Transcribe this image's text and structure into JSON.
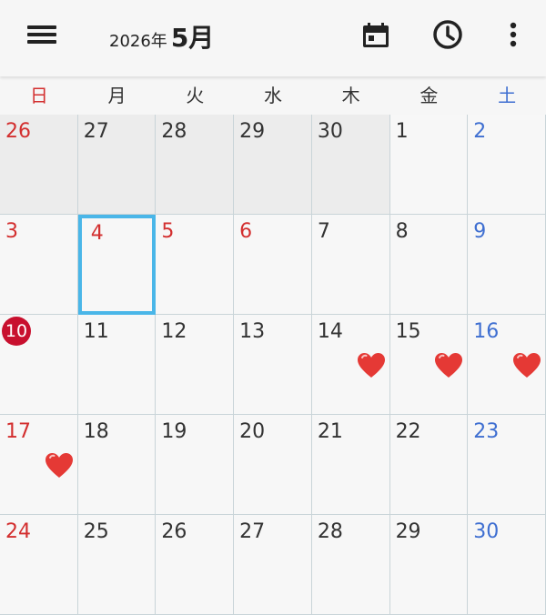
{
  "header": {
    "year_label": "2026年",
    "month_label": "5月",
    "icons": [
      "menu-icon",
      "calendar-icon",
      "clock-icon",
      "more-vert-icon"
    ]
  },
  "weekdays": [
    "日",
    "月",
    "火",
    "水",
    "木",
    "金",
    "土"
  ],
  "colors": {
    "sunday": "#d32f2f",
    "saturday": "#3f6fd1",
    "today_bg": "#c8102e",
    "selected_border": "#4ab6e8",
    "heart": "#e53935"
  },
  "weeks": [
    [
      {
        "day": "26",
        "other": true
      },
      {
        "day": "27",
        "other": true
      },
      {
        "day": "28",
        "other": true
      },
      {
        "day": "29",
        "other": true
      },
      {
        "day": "30",
        "other": true
      },
      {
        "day": "1"
      },
      {
        "day": "2"
      }
    ],
    [
      {
        "day": "3",
        "holiday": true
      },
      {
        "day": "4",
        "holiday": true,
        "selected": true
      },
      {
        "day": "5",
        "holiday": true
      },
      {
        "day": "6",
        "holiday": true
      },
      {
        "day": "7"
      },
      {
        "day": "8"
      },
      {
        "day": "9"
      }
    ],
    [
      {
        "day": "10",
        "today": true
      },
      {
        "day": "11"
      },
      {
        "day": "12"
      },
      {
        "day": "13"
      },
      {
        "day": "14",
        "heart": true
      },
      {
        "day": "15",
        "heart": true
      },
      {
        "day": "16",
        "heart": true
      }
    ],
    [
      {
        "day": "17",
        "heart": true
      },
      {
        "day": "18"
      },
      {
        "day": "19"
      },
      {
        "day": "20"
      },
      {
        "day": "21"
      },
      {
        "day": "22"
      },
      {
        "day": "23"
      }
    ],
    [
      {
        "day": "24"
      },
      {
        "day": "25"
      },
      {
        "day": "26"
      },
      {
        "day": "27"
      },
      {
        "day": "28"
      },
      {
        "day": "29"
      },
      {
        "day": "30"
      }
    ]
  ]
}
